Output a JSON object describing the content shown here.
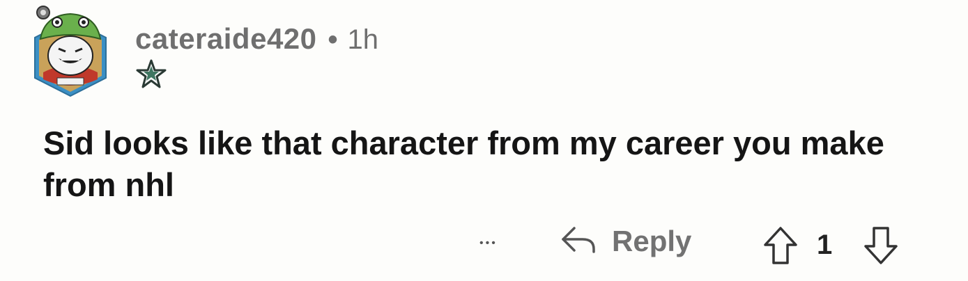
{
  "comment": {
    "username": "cateraide420",
    "separator": "•",
    "time_ago": "1h",
    "flair_icon": "team-star-logo-icon",
    "body": "Sid looks like that character from my career you make from nhl",
    "actions": {
      "more_label": "•••",
      "reply_label": "Reply",
      "reply_icon": "reply-arrow-icon",
      "upvote_icon": "upvote-arrow-icon",
      "score": "1",
      "downvote_icon": "downvote-arrow-icon"
    }
  },
  "colors": {
    "background": "#fdfdfb",
    "username": "#6f6f6f",
    "body_text": "#151515",
    "avatar_hex": "#3a8fc4",
    "avatar_hat": "#6ab04c"
  }
}
